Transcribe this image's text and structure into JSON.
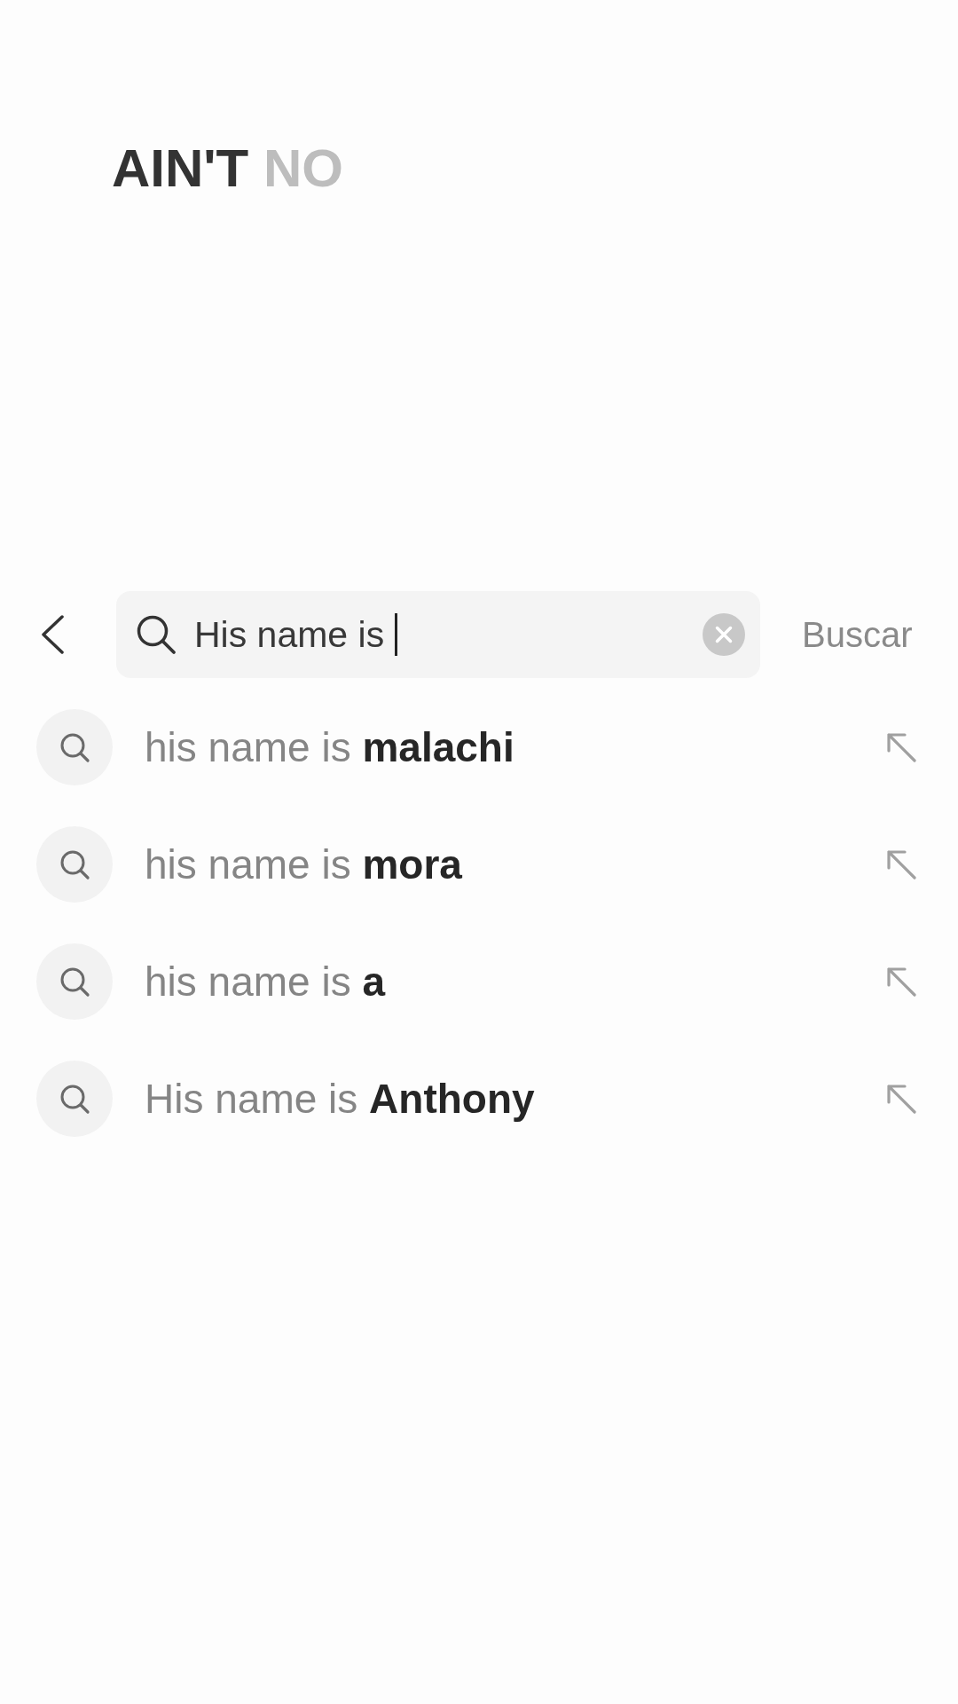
{
  "lyric": {
    "words": [
      {
        "text": "AIN'T",
        "highlighted": true
      },
      {
        "text": "NO",
        "highlighted": false
      }
    ]
  },
  "search_bar": {
    "value": "His name is",
    "focused": true,
    "submit_label": "Buscar"
  },
  "suggestions": [
    {
      "match": "his name is",
      "completion": "malachi"
    },
    {
      "match": "his name is",
      "completion": "mora"
    },
    {
      "match": "his name is",
      "completion": "a"
    },
    {
      "match": "His name is",
      "completion": "Anthony"
    }
  ]
}
